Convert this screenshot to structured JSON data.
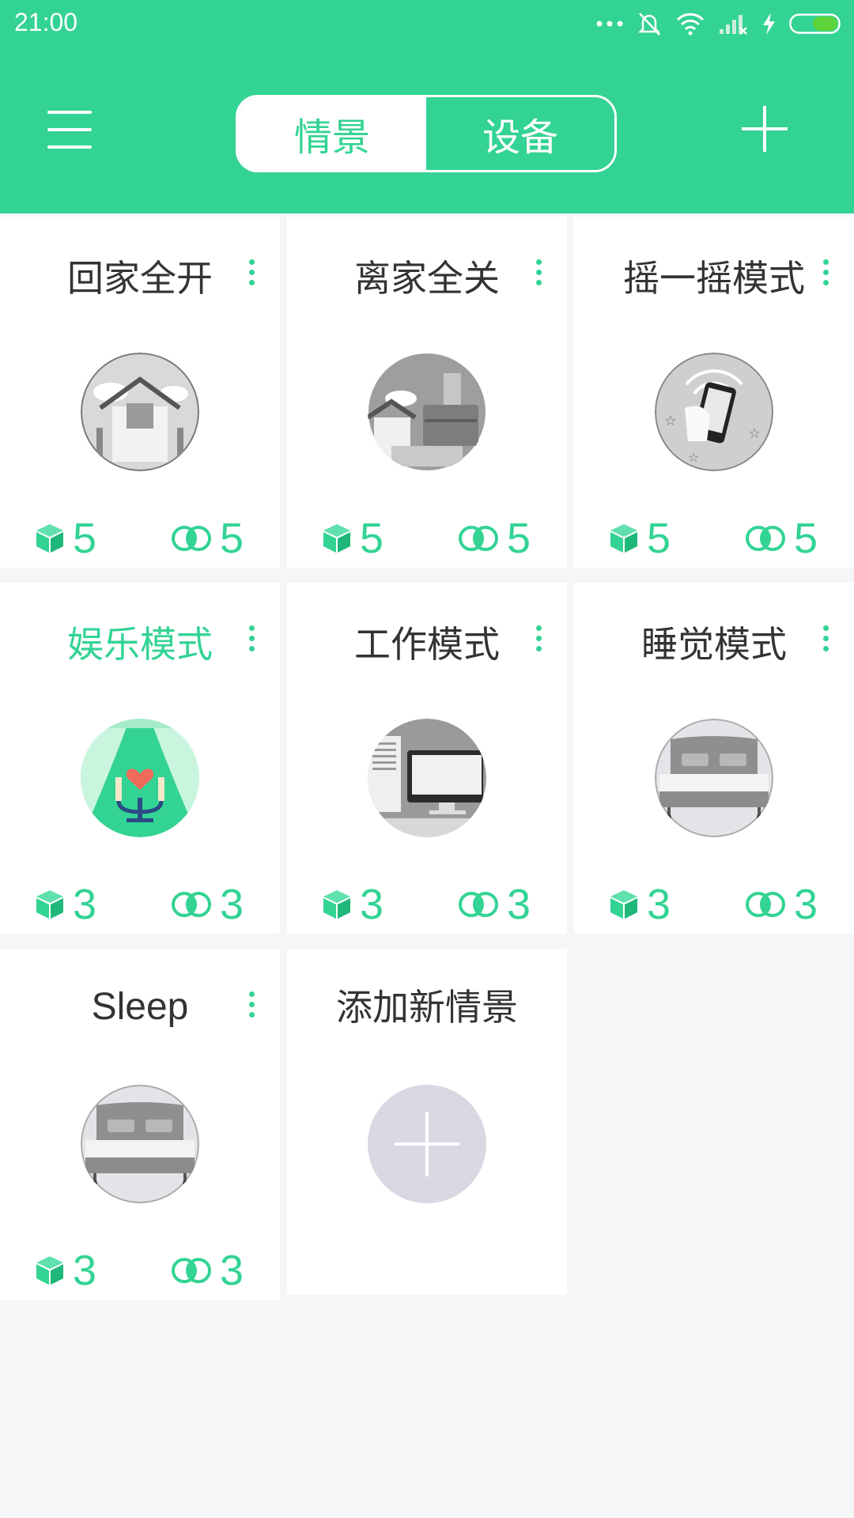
{
  "status_bar": {
    "time": "21:00",
    "icons": [
      "more-dots-icon",
      "mute-icon",
      "wifi-icon",
      "signal-icon",
      "charging-icon",
      "battery-icon"
    ]
  },
  "header": {
    "tabs": [
      {
        "label": "情景",
        "active": true
      },
      {
        "label": "设备",
        "active": false
      }
    ],
    "menu_icon": "hamburger-menu-icon",
    "add_icon": "plus-icon"
  },
  "colors": {
    "accent": "#33d394",
    "background": "#f6f6f6",
    "card": "#ffffff",
    "text": "#333333"
  },
  "scenes": [
    {
      "name": "回家全开",
      "image": "home-image",
      "devices": "5",
      "linkages": "5"
    },
    {
      "name": "离家全关",
      "image": "leave-home-image",
      "devices": "5",
      "linkages": "5"
    },
    {
      "name": "摇一摇模式",
      "image": "shake-phone-image",
      "devices": "5",
      "linkages": "5"
    },
    {
      "name": "娱乐模式",
      "image": "entertainment-image",
      "devices": "3",
      "linkages": "3",
      "highlighted": true
    },
    {
      "name": "工作模式",
      "image": "computer-image",
      "devices": "3",
      "linkages": "3"
    },
    {
      "name": "睡觉模式",
      "image": "bed-image",
      "devices": "3",
      "linkages": "3"
    },
    {
      "name": "Sleep",
      "image": "bed-image",
      "devices": "3",
      "linkages": "3"
    }
  ],
  "add_scene": {
    "label": "添加新情景",
    "icon": "plus-icon"
  }
}
